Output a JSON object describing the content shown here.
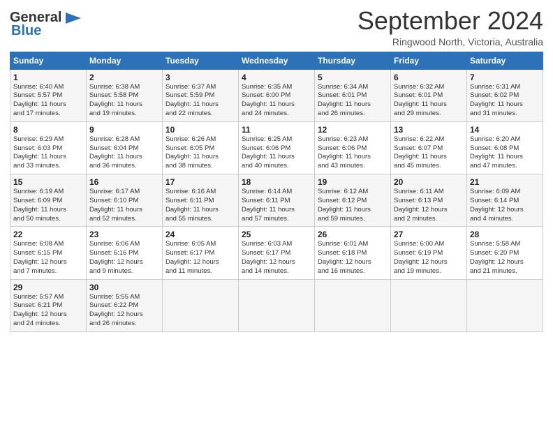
{
  "header": {
    "logo_line1": "General",
    "logo_line2": "Blue",
    "month_title": "September 2024",
    "location": "Ringwood North, Victoria, Australia"
  },
  "weekdays": [
    "Sunday",
    "Monday",
    "Tuesday",
    "Wednesday",
    "Thursday",
    "Friday",
    "Saturday"
  ],
  "weeks": [
    [
      {
        "day": "1",
        "info": "Sunrise: 6:40 AM\nSunset: 5:57 PM\nDaylight: 11 hours\nand 17 minutes."
      },
      {
        "day": "2",
        "info": "Sunrise: 6:38 AM\nSunset: 5:58 PM\nDaylight: 11 hours\nand 19 minutes."
      },
      {
        "day": "3",
        "info": "Sunrise: 6:37 AM\nSunset: 5:59 PM\nDaylight: 11 hours\nand 22 minutes."
      },
      {
        "day": "4",
        "info": "Sunrise: 6:35 AM\nSunset: 6:00 PM\nDaylight: 11 hours\nand 24 minutes."
      },
      {
        "day": "5",
        "info": "Sunrise: 6:34 AM\nSunset: 6:01 PM\nDaylight: 11 hours\nand 26 minutes."
      },
      {
        "day": "6",
        "info": "Sunrise: 6:32 AM\nSunset: 6:01 PM\nDaylight: 11 hours\nand 29 minutes."
      },
      {
        "day": "7",
        "info": "Sunrise: 6:31 AM\nSunset: 6:02 PM\nDaylight: 11 hours\nand 31 minutes."
      }
    ],
    [
      {
        "day": "8",
        "info": "Sunrise: 6:29 AM\nSunset: 6:03 PM\nDaylight: 11 hours\nand 33 minutes."
      },
      {
        "day": "9",
        "info": "Sunrise: 6:28 AM\nSunset: 6:04 PM\nDaylight: 11 hours\nand 36 minutes."
      },
      {
        "day": "10",
        "info": "Sunrise: 6:26 AM\nSunset: 6:05 PM\nDaylight: 11 hours\nand 38 minutes."
      },
      {
        "day": "11",
        "info": "Sunrise: 6:25 AM\nSunset: 6:06 PM\nDaylight: 11 hours\nand 40 minutes."
      },
      {
        "day": "12",
        "info": "Sunrise: 6:23 AM\nSunset: 6:06 PM\nDaylight: 11 hours\nand 43 minutes."
      },
      {
        "day": "13",
        "info": "Sunrise: 6:22 AM\nSunset: 6:07 PM\nDaylight: 11 hours\nand 45 minutes."
      },
      {
        "day": "14",
        "info": "Sunrise: 6:20 AM\nSunset: 6:08 PM\nDaylight: 11 hours\nand 47 minutes."
      }
    ],
    [
      {
        "day": "15",
        "info": "Sunrise: 6:19 AM\nSunset: 6:09 PM\nDaylight: 11 hours\nand 50 minutes."
      },
      {
        "day": "16",
        "info": "Sunrise: 6:17 AM\nSunset: 6:10 PM\nDaylight: 11 hours\nand 52 minutes."
      },
      {
        "day": "17",
        "info": "Sunrise: 6:16 AM\nSunset: 6:11 PM\nDaylight: 11 hours\nand 55 minutes."
      },
      {
        "day": "18",
        "info": "Sunrise: 6:14 AM\nSunset: 6:11 PM\nDaylight: 11 hours\nand 57 minutes."
      },
      {
        "day": "19",
        "info": "Sunrise: 6:12 AM\nSunset: 6:12 PM\nDaylight: 11 hours\nand 59 minutes."
      },
      {
        "day": "20",
        "info": "Sunrise: 6:11 AM\nSunset: 6:13 PM\nDaylight: 12 hours\nand 2 minutes."
      },
      {
        "day": "21",
        "info": "Sunrise: 6:09 AM\nSunset: 6:14 PM\nDaylight: 12 hours\nand 4 minutes."
      }
    ],
    [
      {
        "day": "22",
        "info": "Sunrise: 6:08 AM\nSunset: 6:15 PM\nDaylight: 12 hours\nand 7 minutes."
      },
      {
        "day": "23",
        "info": "Sunrise: 6:06 AM\nSunset: 6:16 PM\nDaylight: 12 hours\nand 9 minutes."
      },
      {
        "day": "24",
        "info": "Sunrise: 6:05 AM\nSunset: 6:17 PM\nDaylight: 12 hours\nand 11 minutes."
      },
      {
        "day": "25",
        "info": "Sunrise: 6:03 AM\nSunset: 6:17 PM\nDaylight: 12 hours\nand 14 minutes."
      },
      {
        "day": "26",
        "info": "Sunrise: 6:01 AM\nSunset: 6:18 PM\nDaylight: 12 hours\nand 16 minutes."
      },
      {
        "day": "27",
        "info": "Sunrise: 6:00 AM\nSunset: 6:19 PM\nDaylight: 12 hours\nand 19 minutes."
      },
      {
        "day": "28",
        "info": "Sunrise: 5:58 AM\nSunset: 6:20 PM\nDaylight: 12 hours\nand 21 minutes."
      }
    ],
    [
      {
        "day": "29",
        "info": "Sunrise: 5:57 AM\nSunset: 6:21 PM\nDaylight: 12 hours\nand 24 minutes."
      },
      {
        "day": "30",
        "info": "Sunrise: 5:55 AM\nSunset: 6:22 PM\nDaylight: 12 hours\nand 26 minutes."
      },
      {
        "day": "",
        "info": ""
      },
      {
        "day": "",
        "info": ""
      },
      {
        "day": "",
        "info": ""
      },
      {
        "day": "",
        "info": ""
      },
      {
        "day": "",
        "info": ""
      }
    ]
  ]
}
